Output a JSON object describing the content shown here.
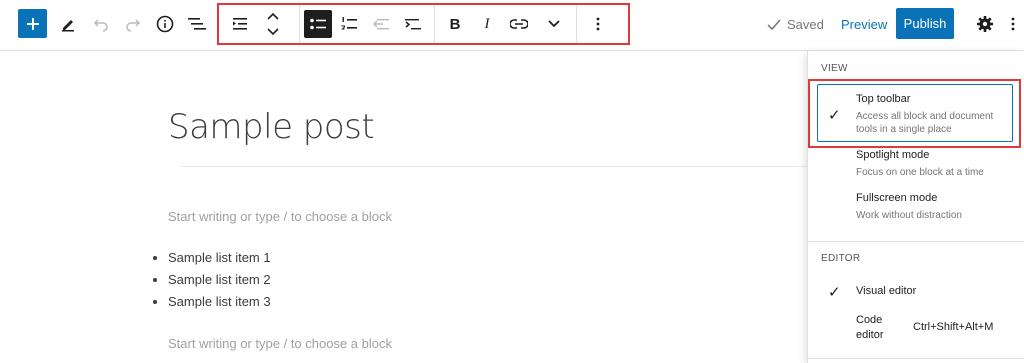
{
  "topbar": {
    "saved_label": "Saved",
    "preview_label": "Preview",
    "publish_label": "Publish",
    "icons": [
      "plus-icon",
      "pencil-icon",
      "undo-icon",
      "redo-icon",
      "info-icon",
      "list-view-icon"
    ]
  },
  "block_toolbar": {
    "icons": [
      "list-indent-icon",
      "move-up-down-icon",
      "bulleted-list-icon",
      "numbered-list-icon",
      "outdent-icon",
      "indent-icon",
      "bold-icon",
      "italic-icon",
      "link-icon",
      "chevron-down-icon",
      "more-options-icon"
    ],
    "active": "bulleted-list-icon",
    "bold_glyph": "B",
    "italic_glyph": "I"
  },
  "post": {
    "title": "Sample post",
    "placeholder_top": "Start writing or type / to choose a block",
    "placeholder_bottom": "Start writing or type / to choose a block",
    "list_items": [
      "Sample list item 1",
      "Sample list item 2",
      "Sample list item 3"
    ]
  },
  "menu": {
    "view_heading": "VIEW",
    "top_toolbar": {
      "title": "Top toolbar",
      "desc": "Access all block and document tools in a single place",
      "checked": true
    },
    "spotlight": {
      "title": "Spotlight mode",
      "desc": "Focus on one block at a time"
    },
    "fullscreen": {
      "title": "Fullscreen mode",
      "desc": "Work without distraction"
    },
    "editor_heading": "EDITOR",
    "visual_editor": {
      "title": "Visual editor",
      "checked": true
    },
    "code_editor": {
      "title_line1": "Code",
      "title_line2": "editor",
      "shortcut": "Ctrl+Shift+Alt+M"
    }
  },
  "colors": {
    "accent": "#0a73b8",
    "highlight": "#e0383b"
  }
}
